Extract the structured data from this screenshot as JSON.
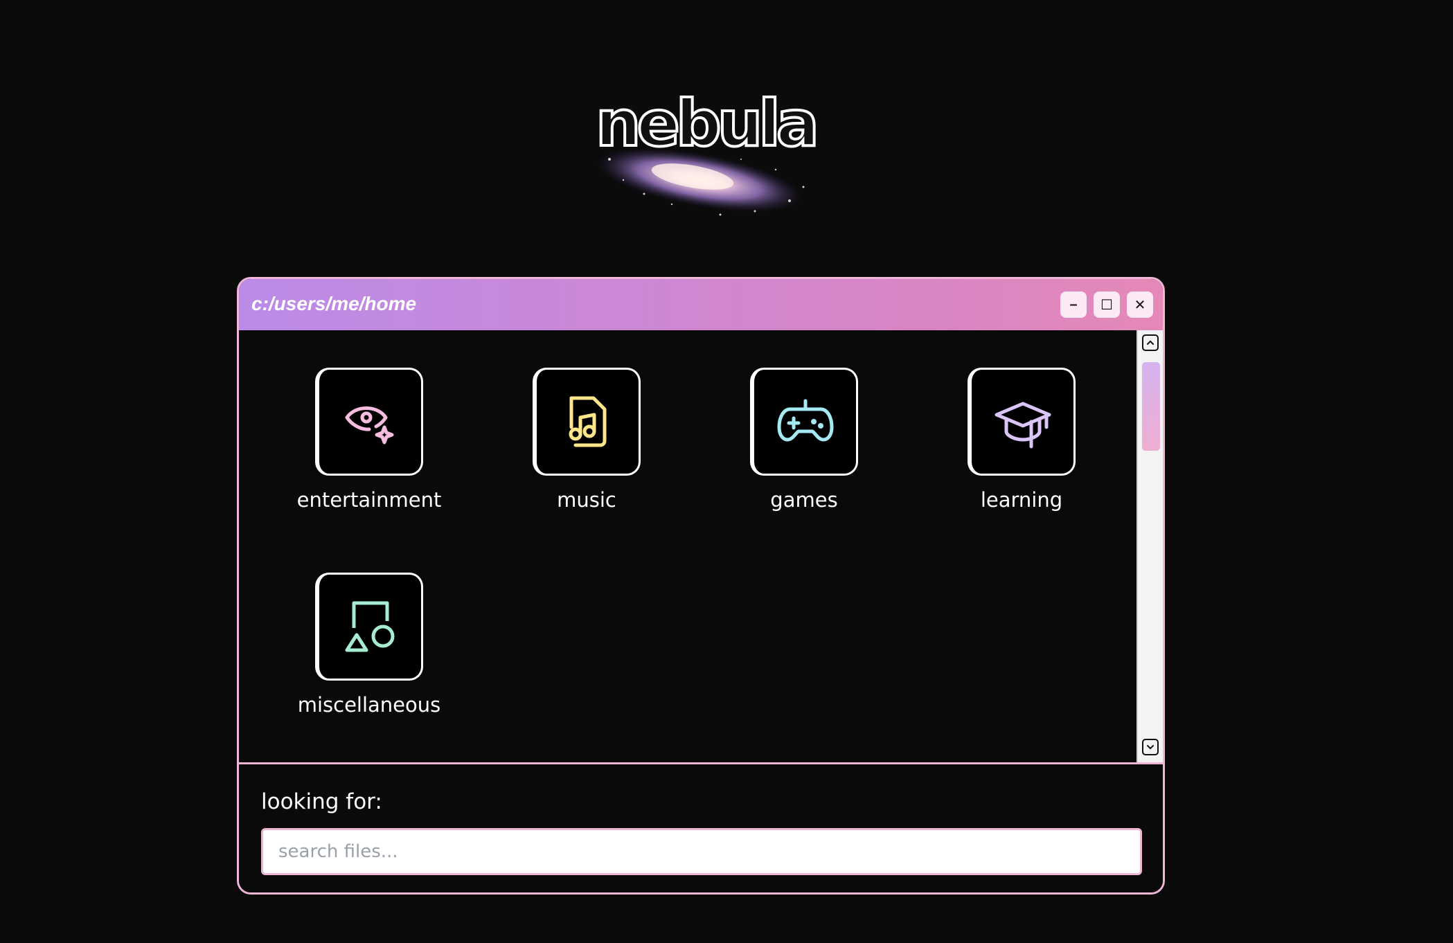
{
  "logo": {
    "text": "nebula",
    "icon": "galaxy-logo"
  },
  "window": {
    "title": "c:/users/me/home",
    "controls": {
      "minimize_label": "–",
      "maximize_label": "☐",
      "close_label": "✕"
    }
  },
  "folders": [
    {
      "label": "entertainment",
      "icon": "eye-sparkle-icon",
      "color": "#f7bde0"
    },
    {
      "label": "music",
      "icon": "music-file-icon",
      "color": "#fde68a"
    },
    {
      "label": "games",
      "icon": "gamepad-icon",
      "color": "#a5e9f5"
    },
    {
      "label": "learning",
      "icon": "graduation-cap-icon",
      "color": "#d9c5f8"
    },
    {
      "label": "miscellaneous",
      "icon": "shapes-icon",
      "color": "#a7ecd0"
    }
  ],
  "scrollbar": {
    "thumb_gradient": [
      "#d5b3ef",
      "#efaed1"
    ]
  },
  "search": {
    "label": "looking for:",
    "placeholder": "search files...",
    "value": ""
  },
  "colors": {
    "background": "#0b0b0c",
    "accent_pink": "#efb6d6",
    "titlebar_start": "#bb8be9",
    "titlebar_end": "#e588b7"
  }
}
